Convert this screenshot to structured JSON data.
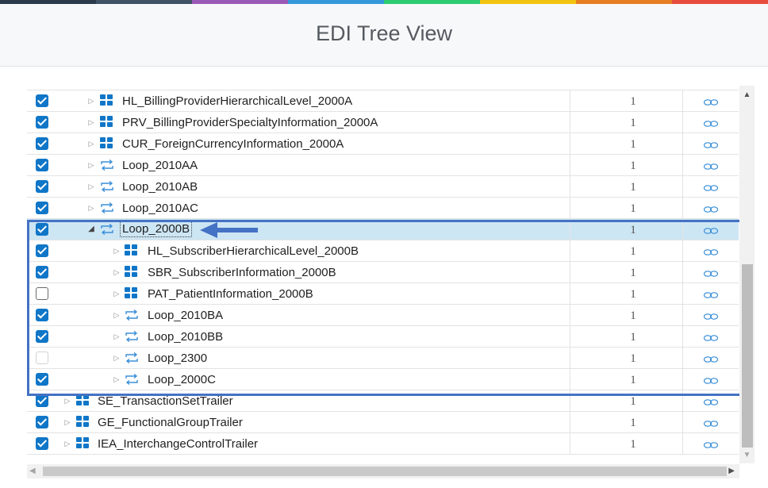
{
  "header": {
    "title": "EDI Tree View",
    "colors": [
      "#2a3a4a",
      "#3f5364",
      "#9b59b6",
      "#3498db",
      "#2ecc71",
      "#f1c40f",
      "#e67e22",
      "#e74c3c"
    ]
  },
  "tree": {
    "rows": [
      {
        "label": "HL_BillingProviderHierarchicalLevel_2000A",
        "icon": "segment-icon",
        "depth": 1,
        "checked": "on",
        "expander": "collapsed",
        "count": "1",
        "selected": false
      },
      {
        "label": "PRV_BillingProviderSpecialtyInformation_2000A",
        "icon": "segment-icon",
        "depth": 1,
        "checked": "on",
        "expander": "collapsed",
        "count": "1",
        "selected": false
      },
      {
        "label": "CUR_ForeignCurrencyInformation_2000A",
        "icon": "segment-icon",
        "depth": 1,
        "checked": "on",
        "expander": "collapsed",
        "count": "1",
        "selected": false
      },
      {
        "label": "Loop_2010AA",
        "icon": "loop-icon",
        "depth": 1,
        "checked": "on",
        "expander": "collapsed",
        "count": "1",
        "selected": false
      },
      {
        "label": "Loop_2010AB",
        "icon": "loop-icon",
        "depth": 1,
        "checked": "on",
        "expander": "collapsed",
        "count": "1",
        "selected": false
      },
      {
        "label": "Loop_2010AC",
        "icon": "loop-icon",
        "depth": 1,
        "checked": "on",
        "expander": "collapsed",
        "count": "1",
        "selected": false
      },
      {
        "label": "Loop_2000B",
        "icon": "loop-icon",
        "depth": 1,
        "checked": "on",
        "expander": "expanded",
        "count": "1",
        "selected": true
      },
      {
        "label": "HL_SubscriberHierarchicalLevel_2000B",
        "icon": "segment-icon",
        "depth": 2,
        "checked": "on",
        "expander": "collapsed",
        "count": "1",
        "selected": false
      },
      {
        "label": "SBR_SubscriberInformation_2000B",
        "icon": "segment-icon",
        "depth": 2,
        "checked": "on",
        "expander": "collapsed",
        "count": "1",
        "selected": false
      },
      {
        "label": "PAT_PatientInformation_2000B",
        "icon": "segment-icon",
        "depth": 2,
        "checked": "off",
        "expander": "collapsed",
        "count": "1",
        "selected": false
      },
      {
        "label": "Loop_2010BA",
        "icon": "loop-icon",
        "depth": 2,
        "checked": "on",
        "expander": "collapsed",
        "count": "1",
        "selected": false
      },
      {
        "label": "Loop_2010BB",
        "icon": "loop-icon",
        "depth": 2,
        "checked": "on",
        "expander": "collapsed",
        "count": "1",
        "selected": false
      },
      {
        "label": "Loop_2300",
        "icon": "loop-icon",
        "depth": 2,
        "checked": "disabled",
        "expander": "collapsed",
        "count": "1",
        "selected": false
      },
      {
        "label": "Loop_2000C",
        "icon": "loop-icon",
        "depth": 2,
        "checked": "on",
        "expander": "collapsed",
        "count": "1",
        "selected": false
      },
      {
        "label": "SE_TransactionSetTrailer",
        "icon": "segment-icon",
        "depth": 0,
        "checked": "on",
        "expander": "collapsed",
        "count": "1",
        "selected": false
      },
      {
        "label": "GE_FunctionalGroupTrailer",
        "icon": "segment-icon",
        "depth": 0,
        "checked": "on",
        "expander": "collapsed",
        "count": "1",
        "selected": false
      },
      {
        "label": "IEA_InterchangeControlTrailer",
        "icon": "segment-icon",
        "depth": 0,
        "checked": "on",
        "expander": "collapsed",
        "count": "1",
        "selected": false
      }
    ],
    "link_icon": "link-icon",
    "accent": "#0f76c8",
    "selected_bg": "#cde6f4",
    "highlight_color": "#4472c4"
  }
}
